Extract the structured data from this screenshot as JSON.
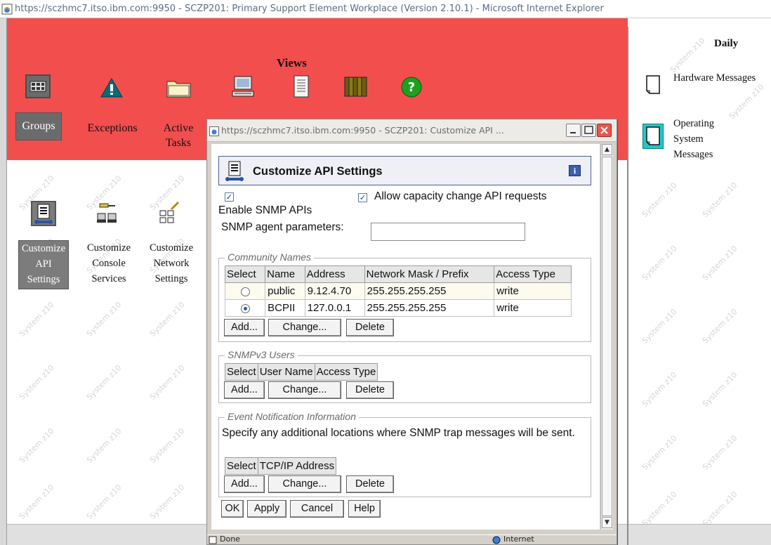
{
  "browser": {
    "title": "https://sczhmc7.itso.ibm.com:9950 - SCZP201: Primary Support Element Workplace (Version 2.10.1) - Microsoft Internet Explorer"
  },
  "views": {
    "title": "Views",
    "items": [
      {
        "label": "Groups",
        "icon": "groups-icon",
        "selected": true
      },
      {
        "label": "Exceptions",
        "icon": "exceptions-icon"
      },
      {
        "label": "Active Tasks",
        "icon": "active-tasks-icon"
      },
      {
        "label": "",
        "icon": "console-actions-icon"
      },
      {
        "label": "",
        "icon": "task-list-icon"
      },
      {
        "label": "",
        "icon": "books-icon"
      },
      {
        "label": "",
        "icon": "help-icon"
      }
    ]
  },
  "tasks": {
    "items": [
      {
        "label": "Customize API Settings",
        "selected": true
      },
      {
        "label": "Customize Console Services"
      },
      {
        "label": "Customize Network Settings"
      }
    ],
    "watermark": "System z10"
  },
  "daily": {
    "title": "Daily",
    "items": [
      {
        "label": "Hardware Messages"
      },
      {
        "label": "Operating System Messages"
      }
    ]
  },
  "dialog": {
    "window_title": "https://sczhmc7.itso.ibm.com:9950 - SCZP201: Customize API ...",
    "header": "Customize API Settings",
    "enable_snmp": {
      "label": "Enable SNMP APIs",
      "checked": true
    },
    "allow_capacity": {
      "label": "Allow capacity change API requests",
      "checked": true
    },
    "snmp_agent": {
      "label": "SNMP agent parameters:",
      "value": ""
    },
    "community": {
      "legend": "Community Names",
      "columns": [
        "Select",
        "Name",
        "Address",
        "Network Mask / Prefix",
        "Access Type"
      ],
      "rows": [
        {
          "selected": false,
          "name": "public",
          "address": "9.12.4.70",
          "mask": "255.255.255.255",
          "access": "write"
        },
        {
          "selected": true,
          "name": "BCPII",
          "address": "127.0.0.1",
          "mask": "255.255.255.255",
          "access": "write"
        }
      ]
    },
    "snmpv3": {
      "legend": "SNMPv3 Users",
      "columns": [
        "Select",
        "User Name",
        "Access Type"
      ]
    },
    "event": {
      "legend": "Event Notification Information",
      "description": "Specify any additional locations where SNMP trap messages will be sent.",
      "columns": [
        "Select",
        "TCP/IP Address"
      ]
    },
    "buttons": {
      "add": "Add...",
      "change": "Change...",
      "delete": "Delete"
    },
    "footer_buttons": {
      "ok": "OK",
      "apply": "Apply",
      "cancel": "Cancel",
      "help": "Help"
    },
    "status": {
      "left": "Done",
      "zone": "Internet"
    }
  },
  "colors": {
    "views_background": "#f24e4e",
    "selection": "#6b6b6b",
    "dialog_accent": "#4e5e8e"
  }
}
